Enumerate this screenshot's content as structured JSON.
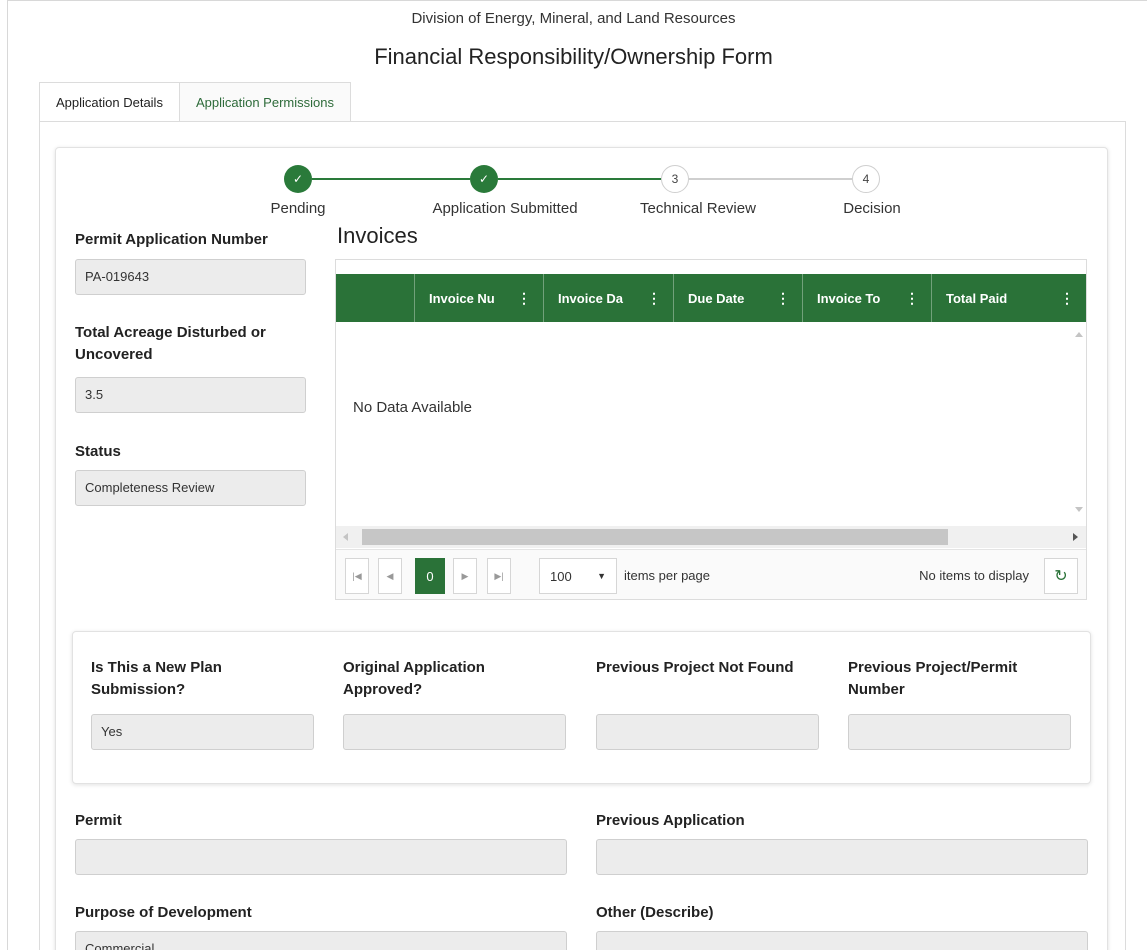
{
  "header": {
    "division": "Division of Energy, Mineral, and Land Resources",
    "form_title": "Financial Responsibility/Ownership Form"
  },
  "tabs": [
    {
      "label": "Application Details",
      "active": true
    },
    {
      "label": "Application Permissions",
      "active": false
    }
  ],
  "stepper": {
    "steps": [
      {
        "label": "Pending",
        "status": "done",
        "marker": "✓"
      },
      {
        "label": "Application Submitted",
        "status": "done",
        "marker": "✓"
      },
      {
        "label": "Technical Review",
        "status": "todo",
        "marker": "3"
      },
      {
        "label": "Decision",
        "status": "todo",
        "marker": "4"
      }
    ]
  },
  "summary": {
    "permit_application_number_label": "Permit Application Number",
    "permit_application_number": "PA-019643",
    "acreage_label": "Total Acreage Disturbed or Uncovered",
    "acreage": "3.5",
    "status_label": "Status",
    "status": "Completeness Review"
  },
  "invoices": {
    "title": "Invoices",
    "columns": [
      "Invoice Nu",
      "Invoice Da",
      "Due Date",
      "Invoice To",
      "Total Paid"
    ],
    "empty_message": "No Data Available",
    "pager": {
      "first_icon": "first-page-icon",
      "prev_icon": "prev-page-icon",
      "current_page": "0",
      "next_icon": "next-page-icon",
      "last_icon": "last-page-icon",
      "page_size": "100",
      "items_per_page_label": "items per page",
      "status": "No items to display",
      "refresh_icon": "refresh-icon"
    }
  },
  "plan_panel": {
    "new_plan_label": "Is This a New Plan Submission?",
    "new_plan_value": "Yes",
    "original_approved_label": "Original Application Approved?",
    "original_approved_value": "",
    "prev_not_found_label": "Previous Project Not Found",
    "prev_not_found_value": "",
    "prev_permit_label": "Previous Project/Permit Number",
    "prev_permit_value": ""
  },
  "details": {
    "permit_label": "Permit",
    "permit_value": "",
    "previous_application_label": "Previous Application",
    "previous_application_value": "",
    "purpose_label": "Purpose of Development",
    "purpose_value": "Commercial",
    "other_label": "Other (Describe)",
    "other_value": ""
  },
  "colors": {
    "brand_green": "#2a7238",
    "step_done": "#2a7a3a"
  }
}
